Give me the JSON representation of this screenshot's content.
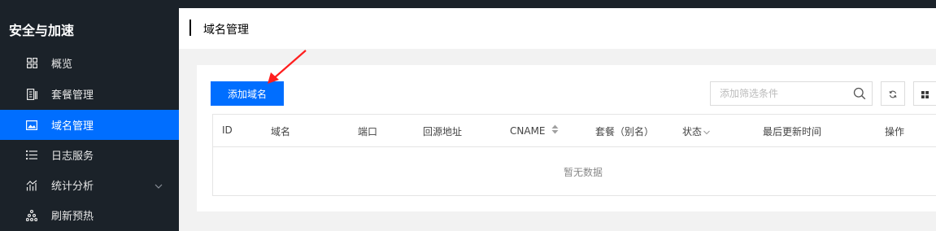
{
  "sidebar": {
    "brand": "安全与加速",
    "items": [
      {
        "label": "概览",
        "icon": "grid-icon"
      },
      {
        "label": "套餐管理",
        "icon": "package-icon"
      },
      {
        "label": "域名管理",
        "icon": "image-icon"
      },
      {
        "label": "日志服务",
        "icon": "list-icon"
      },
      {
        "label": "统计分析",
        "icon": "chart-icon"
      },
      {
        "label": "刷新预热",
        "icon": "tree-icon"
      }
    ],
    "active_index": 2
  },
  "header": {
    "title": "域名管理"
  },
  "toolbar": {
    "add_label": "添加域名",
    "search_placeholder": "添加筛选条件"
  },
  "table": {
    "columns": [
      "ID",
      "域名",
      "端口",
      "回源地址",
      "CNAME",
      "套餐（别名）",
      "状态",
      "最后更新时间",
      "操作"
    ],
    "empty_text": "暂无数据"
  },
  "colors": {
    "sidebar_bg": "#1b2229",
    "accent": "#006eff",
    "annotation": "#ff1e1e"
  }
}
